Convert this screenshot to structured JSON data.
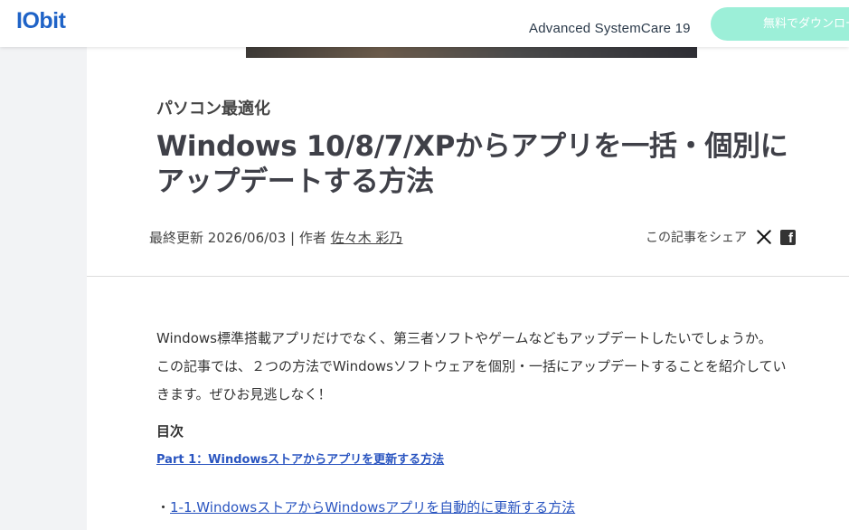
{
  "header": {
    "logo": "IObit",
    "product_name": "Advanced SystemCare 19",
    "download_label": "無料でダウンロード"
  },
  "article": {
    "category": "パソコン最適化",
    "title": "Windows 10/8/7/XPからアプリを一括・個別にアップデートする方法",
    "meta": {
      "updated_label": "最終更新",
      "date": "2026/06/03",
      "separator": "|",
      "author_label": "作者",
      "author": "佐々木 彩乃"
    },
    "share": {
      "label": "この記事をシェア",
      "icons": [
        "x-icon",
        "facebook-icon"
      ]
    },
    "intro": [
      "Windows標準搭載アプリだけでなく、第三者ソフトやゲームなどもアップデートしたいでしょうか。",
      "この記事では、２つの方法でWindowsソフトウェアを個別・一括にアップデートすることを紹介していきます。ぜひお見逃しなく！"
    ],
    "toc": {
      "heading": "目次",
      "part1": "Part 1：Windowsストアからアプリを更新する方法",
      "item_bullet": "・",
      "item1": "1-1.WindowsストアからWindowsアプリを自動的に更新する方法"
    }
  },
  "colors": {
    "logo": "#1f63c7",
    "download_button": "#9cefd8",
    "link": "#2a55c0"
  }
}
